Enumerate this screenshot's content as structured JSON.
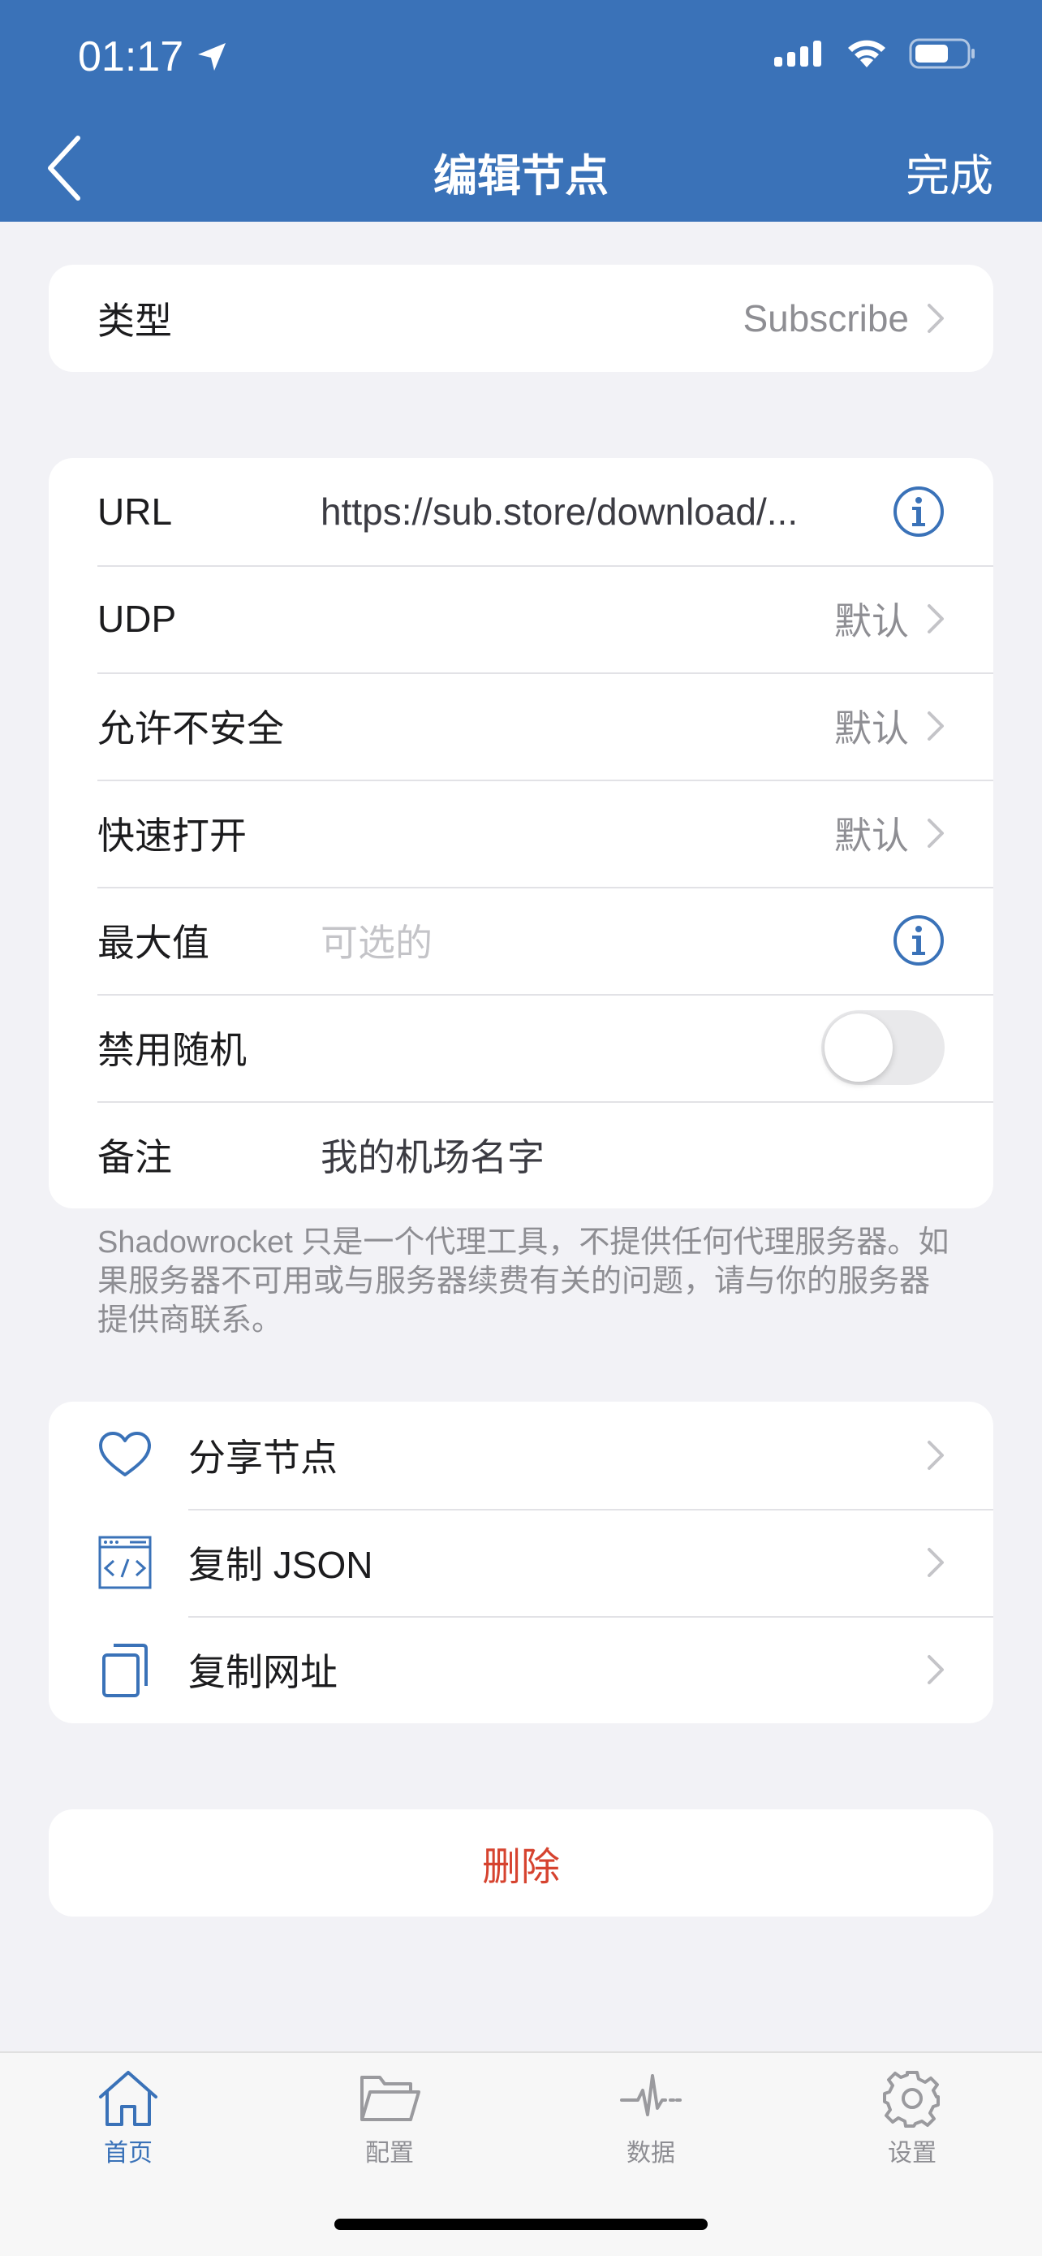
{
  "status_bar": {
    "time": "01:17"
  },
  "nav": {
    "title": "编辑节点",
    "done_label": "完成"
  },
  "type_row": {
    "label": "类型",
    "value": "Subscribe"
  },
  "settings": {
    "url": {
      "label": "URL",
      "value": "https://sub.store/download/..."
    },
    "udp": {
      "label": "UDP",
      "value": "默认"
    },
    "allow_insecure": {
      "label": "允许不安全",
      "value": "默认"
    },
    "fast_open": {
      "label": "快速打开",
      "value": "默认"
    },
    "max_value": {
      "label": "最大值",
      "placeholder": "可选的"
    },
    "disable_random": {
      "label": "禁用随机",
      "enabled": false
    },
    "remark": {
      "label": "备注",
      "value": "我的机场名字"
    }
  },
  "disclaimer": "Shadowrocket 只是一个代理工具，不提供任何代理服务器。如果服务器不可用或与服务器续费有关的问题，请与你的服务器提供商联系。",
  "actions": [
    {
      "label": "分享节点",
      "icon": "heart-icon"
    },
    {
      "label": "复制 JSON",
      "icon": "code-icon"
    },
    {
      "label": "复制网址",
      "icon": "copy-icon"
    }
  ],
  "delete_label": "删除",
  "tabbar": {
    "items": [
      {
        "label": "首页",
        "icon": "home-icon",
        "active": true
      },
      {
        "label": "配置",
        "icon": "folder-icon",
        "active": false
      },
      {
        "label": "数据",
        "icon": "pulse-icon",
        "active": false
      },
      {
        "label": "设置",
        "icon": "gear-icon",
        "active": false
      }
    ]
  },
  "colors": {
    "accent": "#3a72b8",
    "destructive": "#d6432f",
    "background": "#f2f2f6"
  }
}
